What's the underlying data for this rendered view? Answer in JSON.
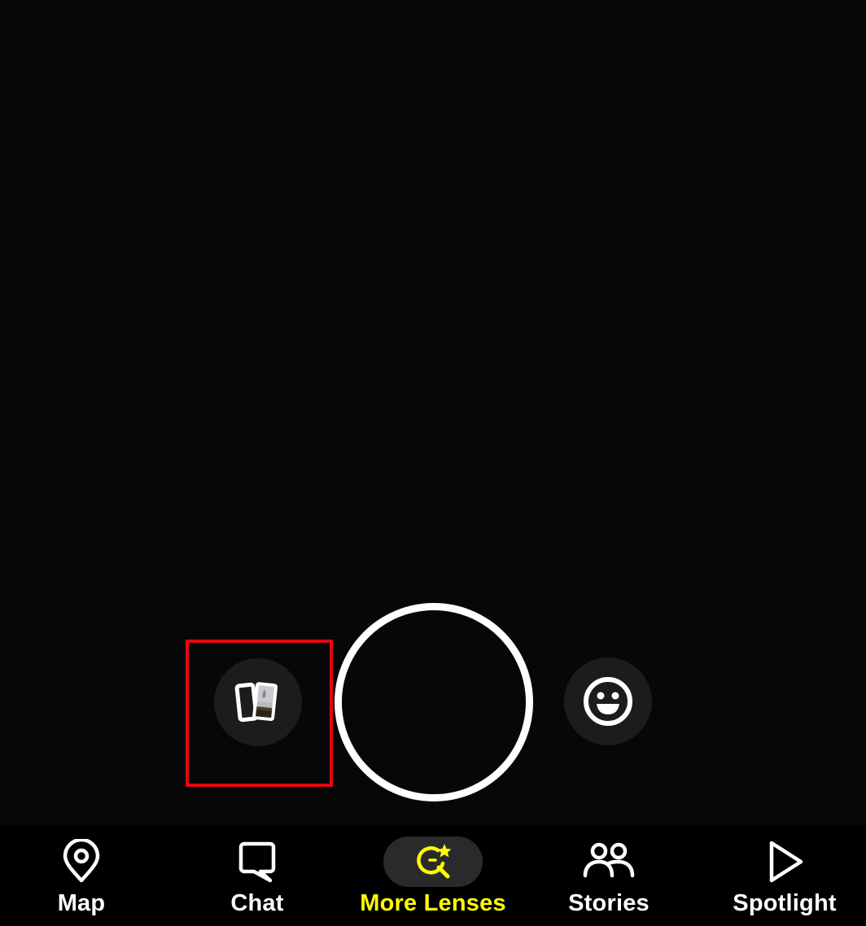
{
  "colors": {
    "background": "#070707",
    "navbar": "#000000",
    "accent": "#fffc00",
    "highlight": "#e30613",
    "icon": "#ffffff"
  },
  "camera": {
    "memories_icon": "memories-cards-icon",
    "shutter_icon": "capture-shutter",
    "lens_icon": "smiley-face-icon"
  },
  "nav": {
    "active": "More Lenses",
    "items": [
      {
        "label": "Map",
        "icon": "map-pin-icon"
      },
      {
        "label": "Chat",
        "icon": "chat-bubble-icon"
      },
      {
        "label": "More Lenses",
        "icon": "lens-search-sparkle-icon"
      },
      {
        "label": "Stories",
        "icon": "people-icon"
      },
      {
        "label": "Spotlight",
        "icon": "play-triangle-icon"
      }
    ]
  }
}
